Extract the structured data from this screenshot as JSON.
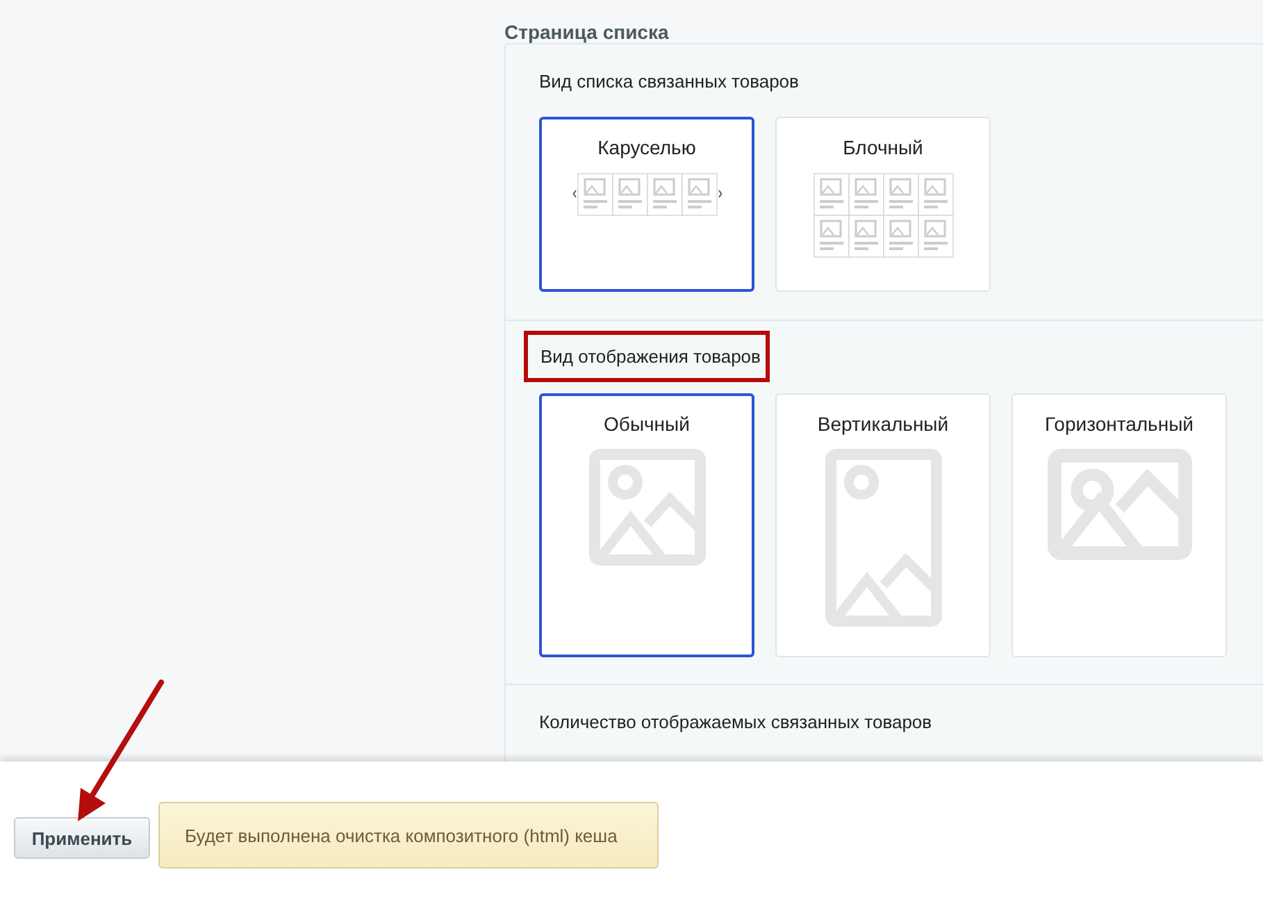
{
  "page_title": "Страница списка",
  "sections": [
    {
      "label": "Вид списка связанных товаров",
      "highlighted": false,
      "options": [
        {
          "label": "Каруселью",
          "kind": "carousel",
          "selected": true
        },
        {
          "label": "Блочный",
          "kind": "grid",
          "selected": false
        }
      ]
    },
    {
      "label": "Вид отображения товаров",
      "highlighted": true,
      "options": [
        {
          "label": "Обычный",
          "kind": "normal",
          "selected": true
        },
        {
          "label": "Вертикальный",
          "kind": "vertical",
          "selected": false
        },
        {
          "label": "Горизонтальный",
          "kind": "horizontal",
          "selected": false
        }
      ]
    },
    {
      "label": "Количество отображаемых связанных товаров",
      "highlighted": false
    }
  ],
  "pointer_arrow": true,
  "footer": {
    "apply_button": "Применить",
    "notice": "Будет выполнена очистка композитного (html) кеша"
  }
}
